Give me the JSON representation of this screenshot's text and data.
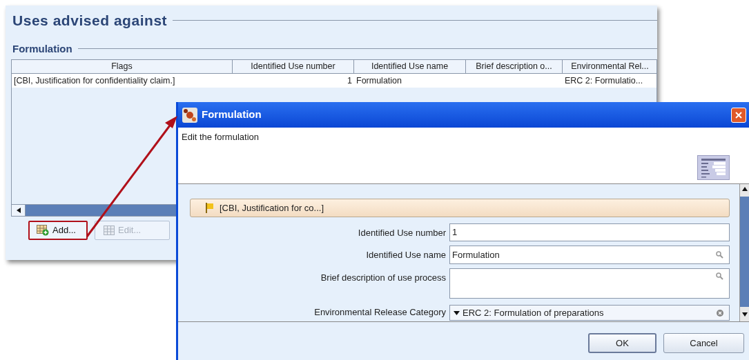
{
  "background_panel": {
    "title": "Uses advised against",
    "section": "Formulation",
    "table": {
      "columns": [
        "Flags",
        "Identified Use number",
        "Identified Use name",
        "Brief description o...",
        "Environmental Rel..."
      ],
      "rows": [
        {
          "cells": [
            "[CBI, Justification for confidentiality claim.]",
            "1",
            "Formulation",
            null,
            "ERC 2: Formulatio..."
          ]
        }
      ]
    },
    "buttons": [
      {
        "label": "Add...",
        "disabled": false,
        "highlighted": true
      },
      {
        "label": "Edit...",
        "disabled": true,
        "highlighted": false
      }
    ]
  },
  "dialog": {
    "title": "Formulation",
    "description": "Edit the formulation",
    "flags_bar": "[CBI, Justification for co...]",
    "fields": [
      {
        "kind": "text",
        "label": "Identified Use number",
        "value": "1"
      },
      {
        "kind": "lookup",
        "label": "Identified Use name",
        "value": "Formulation"
      },
      {
        "kind": "textarea",
        "label": "Brief description of use process"
      },
      {
        "kind": "picklist",
        "label": "Environmental Release Category",
        "value": "ERC 2: Formulation of preparations"
      }
    ],
    "buttons": [
      "OK",
      "Cancel"
    ]
  }
}
